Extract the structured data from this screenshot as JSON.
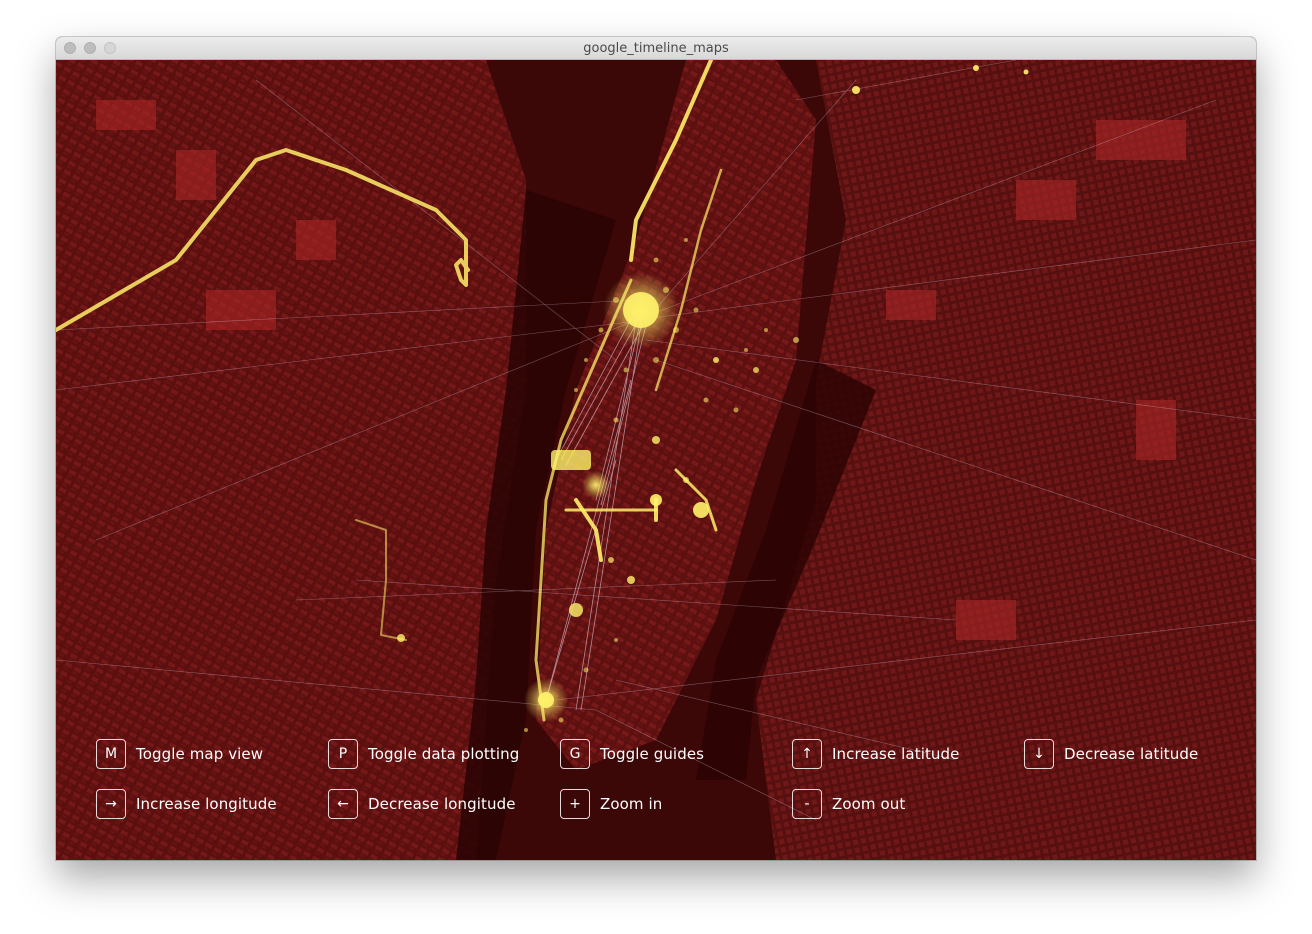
{
  "window": {
    "title": "google_timeline_maps"
  },
  "colors": {
    "map_base": "#3a0606",
    "map_dense": "#6e1414",
    "highlight": "#fff36a",
    "trace": "#e8e4ff"
  },
  "controls": [
    {
      "key": "M",
      "label": "Toggle map view"
    },
    {
      "key": "P",
      "label": "Toggle data plotting"
    },
    {
      "key": "G",
      "label": "Toggle guides"
    },
    {
      "key": "↑",
      "label": "Increase latitude"
    },
    {
      "key": "↓",
      "label": "Decrease latitude"
    },
    {
      "key": "→",
      "label": "Increase longitude"
    },
    {
      "key": "←",
      "label": "Decrease longitude"
    },
    {
      "key": "+",
      "label": "Zoom in"
    },
    {
      "key": "-",
      "label": "Zoom out"
    }
  ]
}
